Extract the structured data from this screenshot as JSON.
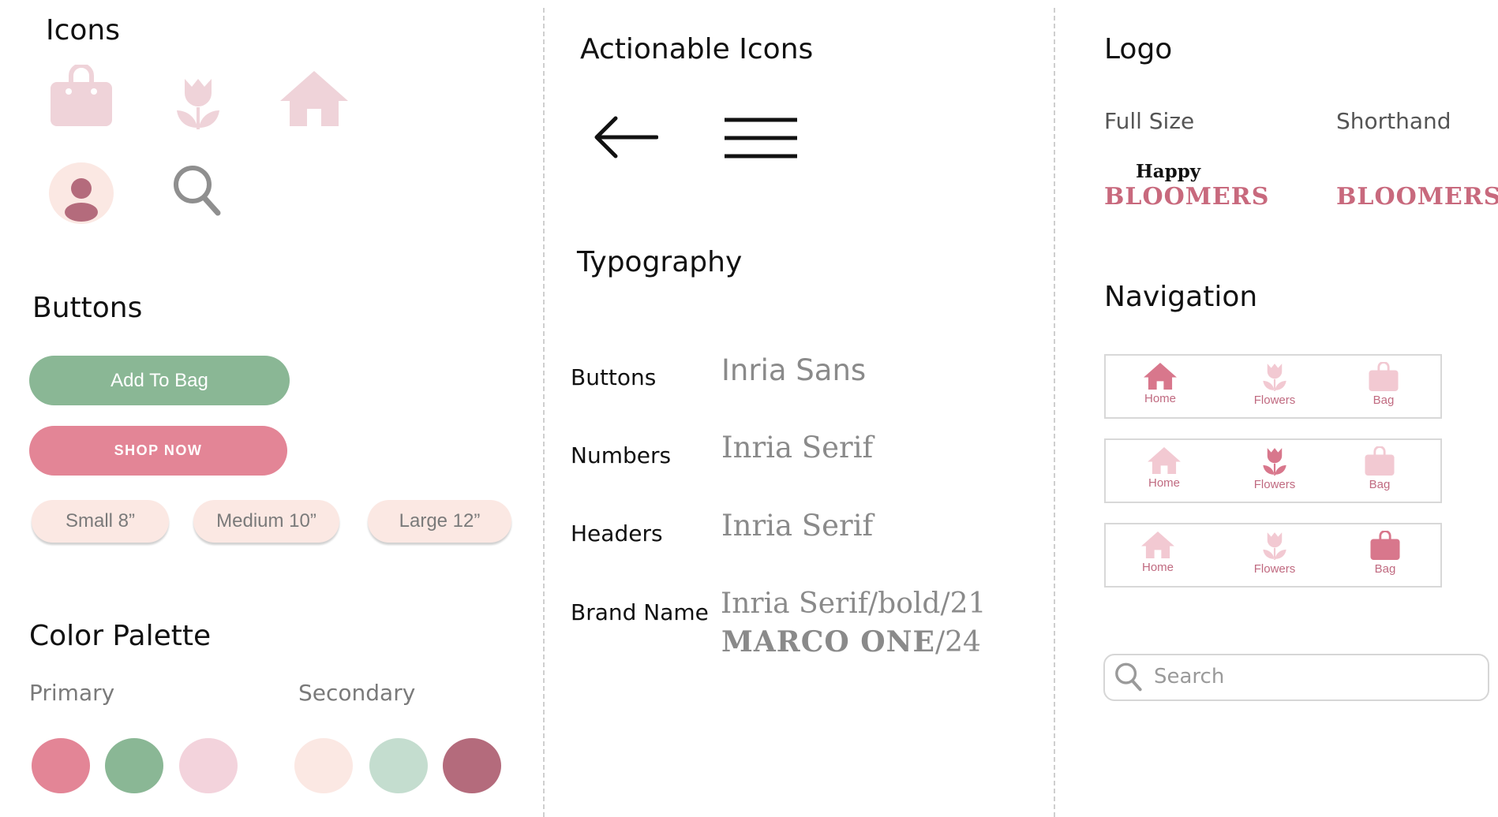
{
  "colors": {
    "primary_pink": "#e38596",
    "primary_green": "#8ab795",
    "light_pink": "#f3d3dc",
    "cream": "#fbe8e3",
    "sage": "#c4ddcf",
    "mauve": "#b46b7c",
    "icon_pink": "#efd3d9",
    "nav_active": "#d8778c",
    "nav_inactive": "#f2c9d2"
  },
  "icons_section": {
    "title": "Icons",
    "icons": [
      "bag-icon",
      "tulip-icon",
      "home-icon",
      "user-icon",
      "search-icon"
    ]
  },
  "buttons_section": {
    "title": "Buttons",
    "add_to_bag": "Add To Bag",
    "shop_now": "SHOP NOW",
    "sizes": [
      "Small 8”",
      "Medium 10”",
      "Large 12”"
    ]
  },
  "palette_section": {
    "title": "Color Palette",
    "primary_label": "Primary",
    "secondary_label": "Secondary",
    "primary": [
      "#e38596",
      "#8ab795",
      "#f3d3dc"
    ],
    "secondary": [
      "#fbe8e3",
      "#c4ddcf",
      "#b46b7c"
    ]
  },
  "actionable_section": {
    "title": "Actionable Icons",
    "icons": [
      "back-arrow-icon",
      "hamburger-menu-icon"
    ]
  },
  "typography_section": {
    "title": "Typography",
    "rows": [
      {
        "label": "Buttons",
        "value": "Inria Sans"
      },
      {
        "label": "Numbers",
        "value": "Inria Serif"
      },
      {
        "label": "Headers",
        "value": "Inria Serif"
      },
      {
        "label": "Brand Name",
        "value": "Inria Serif/bold/21",
        "value2_bold": "MARCO ONE",
        "value2_rest": "/24"
      }
    ]
  },
  "logo_section": {
    "title": "Logo",
    "full_size_label": "Full Size",
    "shorthand_label": "Shorthand",
    "full_top": "Happy",
    "full_bottom": "BLOOMERS",
    "shorthand": "BLOOMERS"
  },
  "navigation_section": {
    "title": "Navigation",
    "bars": [
      {
        "active": "Home",
        "items": [
          "Home",
          "Flowers",
          "Bag"
        ]
      },
      {
        "active": "Flowers",
        "items": [
          "Home",
          "Flowers",
          "Bag"
        ]
      },
      {
        "active": "Bag",
        "items": [
          "Home",
          "Flowers",
          "Bag"
        ]
      }
    ]
  },
  "search": {
    "placeholder": "Search"
  }
}
